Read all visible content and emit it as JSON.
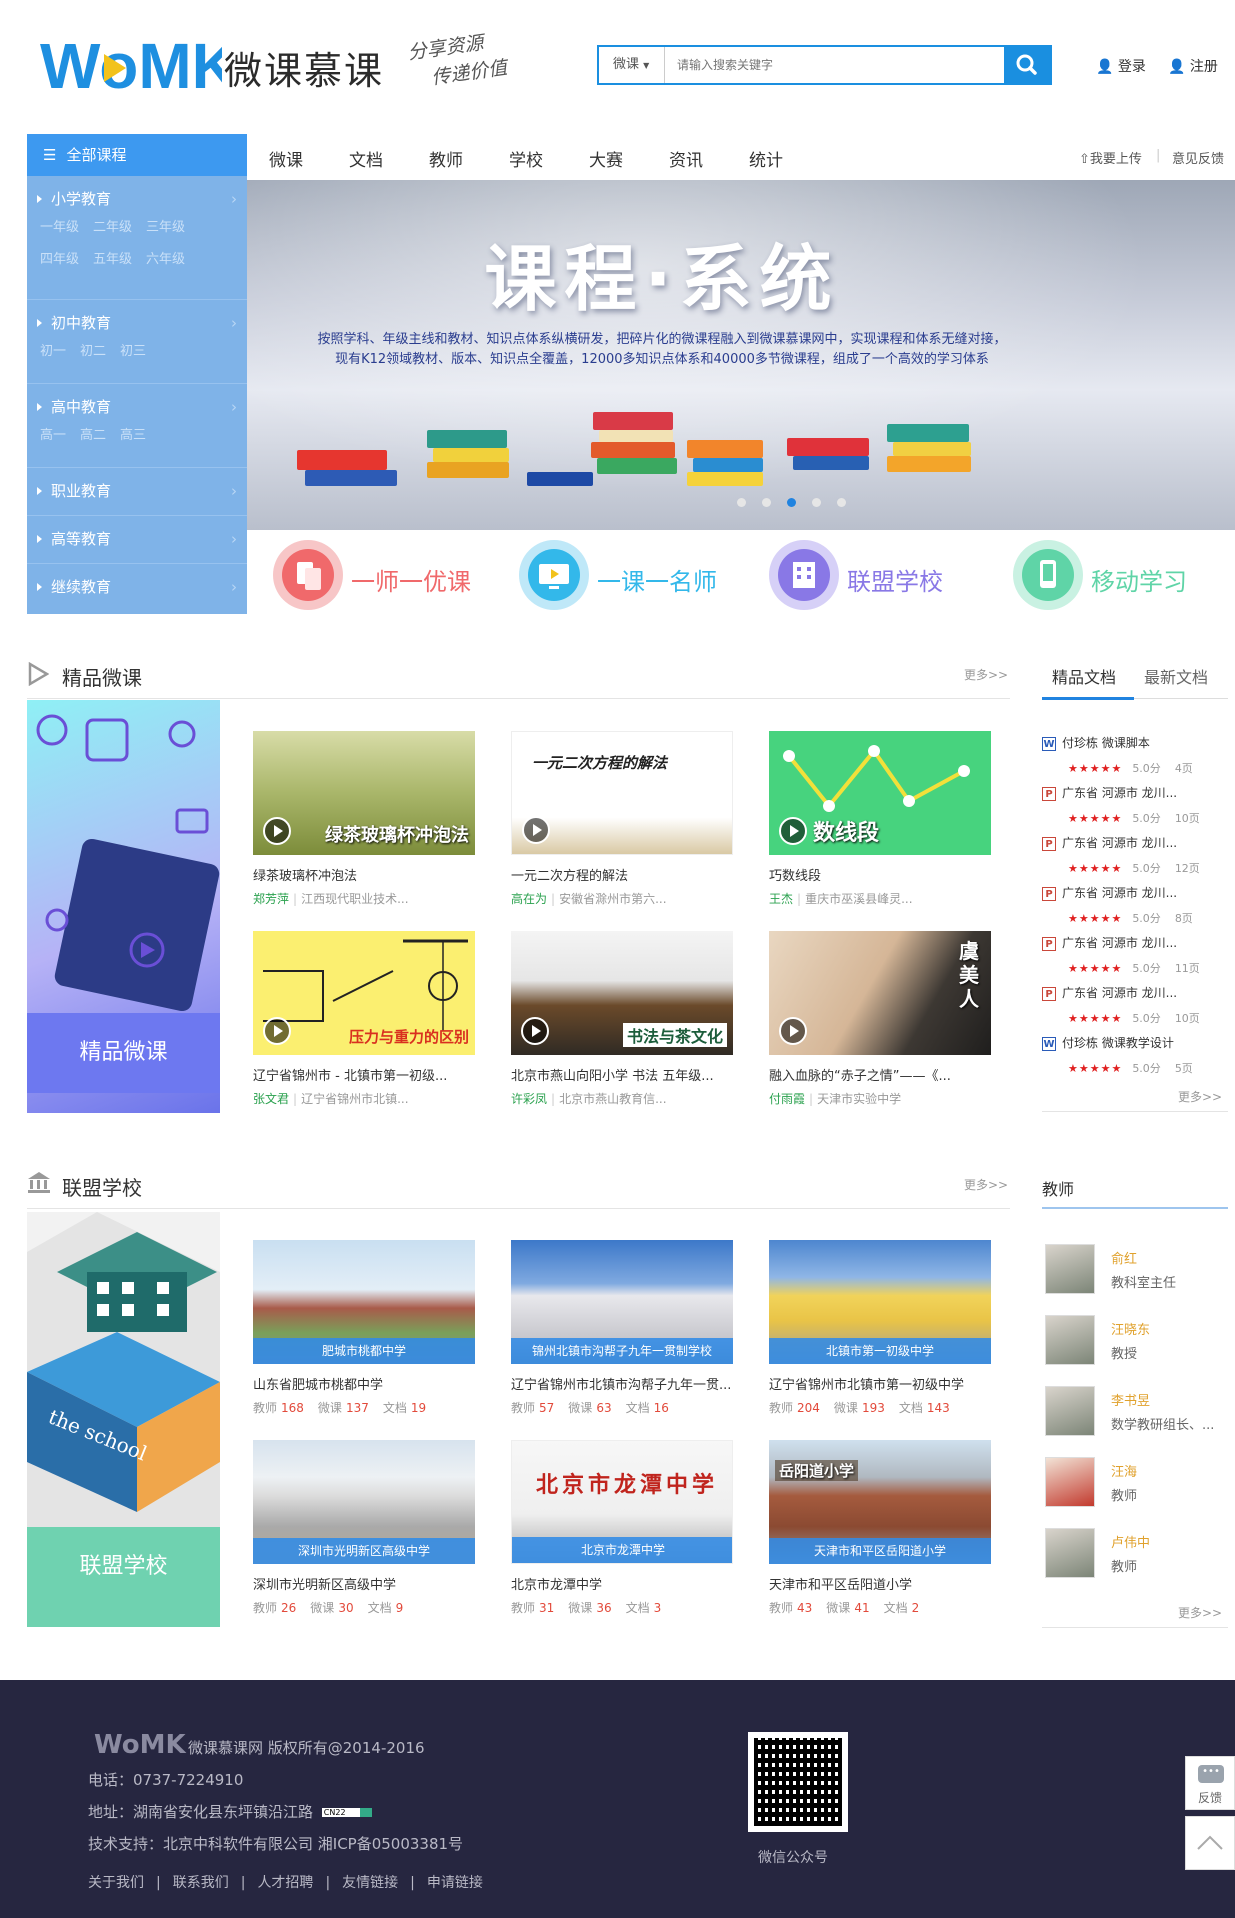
{
  "header": {
    "logo_text": "WoMK",
    "site_name": "微课慕课",
    "slogan_line1": "分享资源",
    "slogan_line2": "传递价值",
    "search_scope": "微课",
    "search_placeholder": "请输入搜索关键字",
    "login": "登录",
    "register": "注册"
  },
  "menu": {
    "head": "全部课程",
    "groups": [
      {
        "label": "小学教育",
        "subs": [
          "一年级",
          "二年级",
          "三年级",
          "四年级",
          "五年级",
          "六年级"
        ]
      },
      {
        "label": "初中教育",
        "subs": [
          "初一",
          "初二",
          "初三"
        ]
      },
      {
        "label": "高中教育",
        "subs": [
          "高一",
          "高二",
          "高三"
        ]
      },
      {
        "label": "职业教育",
        "subs": []
      },
      {
        "label": "高等教育",
        "subs": []
      },
      {
        "label": "继续教育",
        "subs": []
      }
    ]
  },
  "nav": {
    "items": [
      "微课",
      "文档",
      "教师",
      "学校",
      "大赛",
      "资讯",
      "统计"
    ],
    "upload": "我要上传",
    "feedback": "意见反馈"
  },
  "banner": {
    "title": "课程·系统",
    "desc_line1": "按照学科、年级主线和教材、知识点体系纵横研发，把碎片化的微课程融入到微课慕课网中，实现课程和体系无缝对接，",
    "desc_line2": "现有K12领域教材、版本、知识点全覆盖，12000多知识点体系和40000多节微课程，组成了一个高效的学习体系"
  },
  "features": [
    {
      "label": "一师一优课",
      "color": "#f0696b",
      "icon": "document-icon"
    },
    {
      "label": "一课一名师",
      "color": "#33b8ea",
      "icon": "monitor-play-icon"
    },
    {
      "label": "联盟学校",
      "color": "#8978e6",
      "icon": "building-icon"
    },
    {
      "label": "移动学习",
      "color": "#5fd4a7",
      "icon": "mobile-icon"
    }
  ],
  "micro": {
    "title": "精品微课",
    "more": "更多>>",
    "promo": "精品微课",
    "cards": [
      {
        "title": "绿茶玻璃杯冲泡法",
        "author": "郑芳萍",
        "org": "江西现代职业技术...",
        "caption": "绿茶玻璃杯冲泡法"
      },
      {
        "title": "一元二次方程的解法",
        "author": "高在为",
        "org": "安徽省滁州市第六...",
        "caption": "一元二次方程的解法"
      },
      {
        "title": "巧数线段",
        "author": "王杰",
        "org": "重庆市巫溪县峰灵...",
        "caption": "数线段"
      },
      {
        "title": "辽宁省锦州市 - 北镇市第一初级...",
        "author": "张文君",
        "org": "辽宁省锦州市北镇...",
        "caption": "压力与重力的区别"
      },
      {
        "title": "北京市燕山向阳小学 书法 五年级...",
        "author": "许彩凤",
        "org": "北京市燕山教育信...",
        "caption": "书法与茶文化"
      },
      {
        "title": "融入血脉的“赤子之情”——《...",
        "author": "付雨霞",
        "org": "天津市实验中学",
        "caption": "虞美人"
      }
    ]
  },
  "docs": {
    "tab_active": "精品文档",
    "tab_other": "最新文档",
    "more": "更多>>",
    "items": [
      {
        "type": "W",
        "title": "付珍栋 微课脚本",
        "score": "5.0分",
        "pages": "4页"
      },
      {
        "type": "P",
        "title": "广东省 河源市 龙川...",
        "score": "5.0分",
        "pages": "10页"
      },
      {
        "type": "P",
        "title": "广东省 河源市 龙川...",
        "score": "5.0分",
        "pages": "12页"
      },
      {
        "type": "P",
        "title": "广东省 河源市 龙川...",
        "score": "5.0分",
        "pages": "8页"
      },
      {
        "type": "P",
        "title": "广东省 河源市 龙川...",
        "score": "5.0分",
        "pages": "11页"
      },
      {
        "type": "P",
        "title": "广东省 河源市 龙川...",
        "score": "5.0分",
        "pages": "10页"
      },
      {
        "type": "W",
        "title": "付珍栋 微课教学设计",
        "score": "5.0分",
        "pages": "5页"
      }
    ],
    "stars": "★★★★★"
  },
  "schools": {
    "title": "联盟学校",
    "more": "更多>>",
    "promo": "联盟学校",
    "promo_sign": "the school",
    "labels": {
      "teacher": "教师",
      "micro": "微课",
      "doc": "文档"
    },
    "cards": [
      {
        "name": "山东省肥城市桃都中学",
        "strip": "肥城市桃都中学",
        "teachers": "168",
        "micro": "137",
        "docs": "19"
      },
      {
        "name": "辽宁省锦州市北镇市沟帮子九年一贯...",
        "strip": "锦州北镇市沟帮子九年一贯制学校",
        "teachers": "57",
        "micro": "63",
        "docs": "16"
      },
      {
        "name": "辽宁省锦州市北镇市第一初级中学",
        "strip": "北镇市第一初级中学",
        "teachers": "204",
        "micro": "193",
        "docs": "143"
      },
      {
        "name": "深圳市光明新区高级中学",
        "strip": "深圳市光明新区高级中学",
        "teachers": "26",
        "micro": "30",
        "docs": "9"
      },
      {
        "name": "北京市龙潭中学",
        "strip": "北京市龙潭中学",
        "teachers": "31",
        "micro": "36",
        "docs": "3",
        "sign": "北京市龙潭中学"
      },
      {
        "name": "天津市和平区岳阳道小学",
        "strip": "天津市和平区岳阳道小学",
        "teachers": "43",
        "micro": "41",
        "docs": "2",
        "sign": "岳阳道小学"
      }
    ]
  },
  "teachers": {
    "title": "教师",
    "more": "更多>>",
    "items": [
      {
        "name": "俞红",
        "title": "教科室主任"
      },
      {
        "name": "汪晓东",
        "title": "教授"
      },
      {
        "name": "李书昱",
        "title": "数学教研组长、..."
      },
      {
        "name": "汪海",
        "title": "教师"
      },
      {
        "name": "卢伟中",
        "title": "教师"
      }
    ]
  },
  "footer": {
    "brand": "WoMK",
    "copyright": "微课慕课网 版权所有@2014-2016",
    "phone": "电话：0737-7224910",
    "address": "地址：湖南省安化县东坪镇沿江路",
    "support": "技术支持：北京中科软件有限公司  湘ICP备05003381号",
    "links": [
      "关于我们",
      "联系我们",
      "人才招聘",
      "友情链接",
      "申请链接"
    ],
    "qr_label": "微信公众号",
    "address_badge": "CN22"
  },
  "floating": {
    "feedback": "反馈"
  }
}
